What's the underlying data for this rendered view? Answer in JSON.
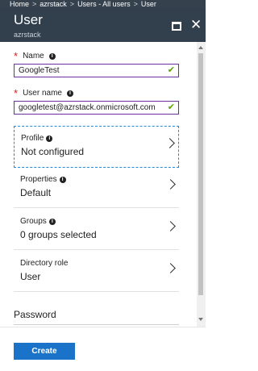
{
  "breadcrumb": [
    "Home",
    "azrstack",
    "Users - All users",
    "User"
  ],
  "blade": {
    "title": "User",
    "subtitle": "azrstack"
  },
  "form": {
    "name": {
      "label": "Name",
      "value": "GoogleTest"
    },
    "user_name": {
      "label": "User name",
      "value": "googletest@azrstack.onmicrosoft.com"
    },
    "nav_items": [
      {
        "label": "Profile",
        "value": "Not configured"
      },
      {
        "label": "Properties",
        "value": "Default"
      },
      {
        "label": "Groups",
        "value": "0 groups selected"
      },
      {
        "label": "Directory role",
        "value": "User"
      }
    ],
    "password_label": "Password"
  },
  "footer": {
    "create_label": "Create"
  },
  "colors": {
    "header_bg": "#32404e",
    "input_border": "#6b2fa0",
    "valid_check": "#57a300",
    "primary_button": "#1a73c8",
    "required_star": "#d81b1b"
  },
  "icons": [
    "maximize-icon",
    "close-icon",
    "info-icon",
    "check-icon",
    "chevron-right-icon"
  ]
}
